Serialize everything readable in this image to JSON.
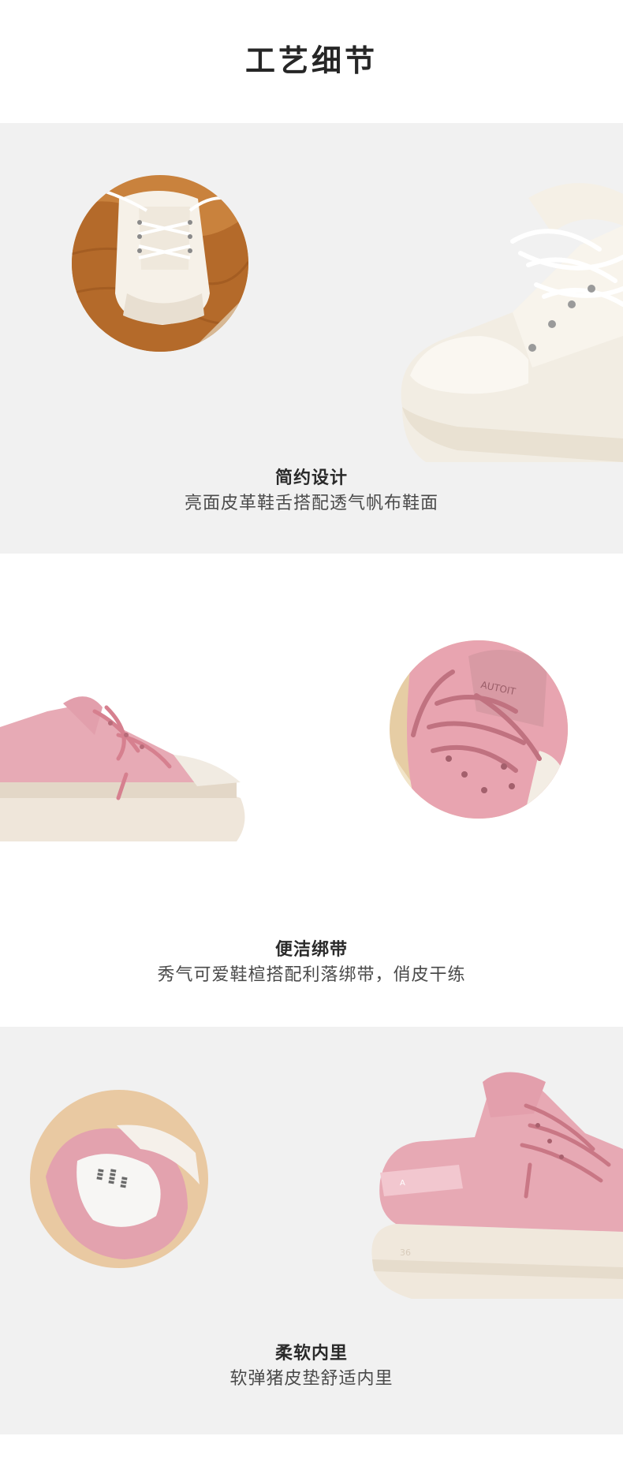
{
  "header": {
    "title": "工艺细节"
  },
  "sections": [
    {
      "title": "简约设计",
      "desc": "亮面皮革鞋舌搭配透气帆布鞋面"
    },
    {
      "title": "便洁绑带",
      "desc": "秀气可爱鞋楦搭配利落绑带，俏皮干练"
    },
    {
      "title": "柔软内里",
      "desc": "软弹猪皮垫舒适内里"
    }
  ]
}
